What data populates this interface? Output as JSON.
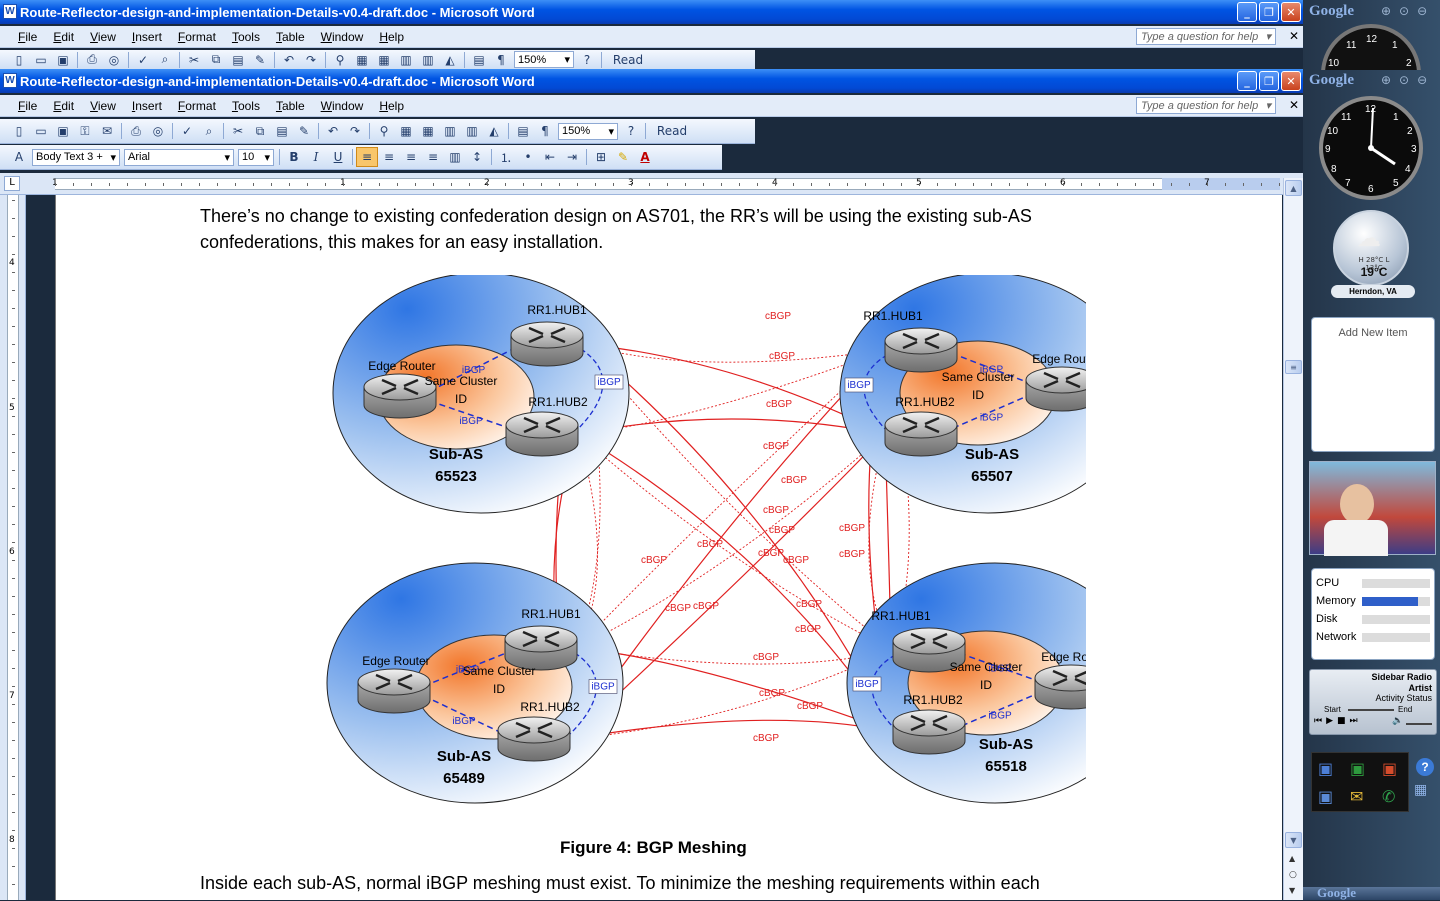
{
  "window": {
    "title": "Route-Reflector-design-and-implementation-Details-v0.4-draft.doc - Microsoft Word",
    "app_icon": "W"
  },
  "menu": [
    "File",
    "Edit",
    "View",
    "Insert",
    "Format",
    "Tools",
    "Table",
    "Window",
    "Help"
  ],
  "help_placeholder": "Type a question for help",
  "toolbar": {
    "zoom": "150%",
    "read_label": "Read"
  },
  "format_bar": {
    "style": "Body Text 3 +",
    "font": "Arial",
    "size": "10"
  },
  "ruler": {
    "h_numbers": [
      "1",
      "1",
      "2",
      "3",
      "4",
      "5",
      "6",
      "7"
    ],
    "v_numbers": [
      "4",
      "5",
      "6",
      "7",
      "8"
    ]
  },
  "document": {
    "para1_line1": "There’s no change to existing confederation design on AS701, the RR’s will be using the existing sub-AS",
    "para1_line2": "confederations, this makes for an easy installation.",
    "caption": "Figure 4: BGP Meshing",
    "para2_line1": "Inside each sub-AS, normal iBGP meshing must exist. To minimize the meshing requirements within each"
  },
  "diagram": {
    "clusters": [
      {
        "sub_as_label": "Sub-AS",
        "as_number": "65523",
        "rr1": "RR1.HUB1",
        "rr2": "RR1.HUB2",
        "edge": "Edge Router",
        "cluster_label": "Same Cluster",
        "cluster_id": "ID"
      },
      {
        "sub_as_label": "Sub-AS",
        "as_number": "65507",
        "rr1": "RR1.HUB1",
        "rr2": "RR1.HUB2",
        "edge": "Edge Router",
        "cluster_label": "Same Cluster",
        "cluster_id": "ID"
      },
      {
        "sub_as_label": "Sub-AS",
        "as_number": "65489",
        "rr1": "RR1.HUB1",
        "rr2": "RR1.HUB2",
        "edge": "Edge Router",
        "cluster_label": "Same Cluster",
        "cluster_id": "ID"
      },
      {
        "sub_as_label": "Sub-AS",
        "as_number": "65518",
        "rr1": "RR1.HUB1",
        "rr2": "RR1.HUB2",
        "edge": "Edge Router",
        "cluster_label": "Same Cluster",
        "cluster_id": "ID"
      }
    ],
    "ibgp": "iBGP",
    "cbgp": "cBGP"
  },
  "sidebar": {
    "brand": "Google",
    "weather_temp": "19°C",
    "weather_range": "H 28°C L 13°C",
    "weather_city": "Herndon, VA",
    "add_item": "Add New Item",
    "meters": [
      {
        "label": "CPU",
        "value": 0.0
      },
      {
        "label": "Memory",
        "value": 0.82
      },
      {
        "label": "Disk",
        "value": 0.0
      },
      {
        "label": "Network",
        "value": 0.0
      }
    ],
    "radio_title": "Sidebar Radio",
    "radio_artist": "Artist",
    "radio_status": "Activity Status",
    "radio_start": "Start",
    "radio_end": "End"
  },
  "colors": {
    "xp_blue": "#0054e3",
    "office_toolbar": "#cfdff5",
    "cbgp_red": "#e02020",
    "ibgp_blue": "#1c2fd0"
  }
}
